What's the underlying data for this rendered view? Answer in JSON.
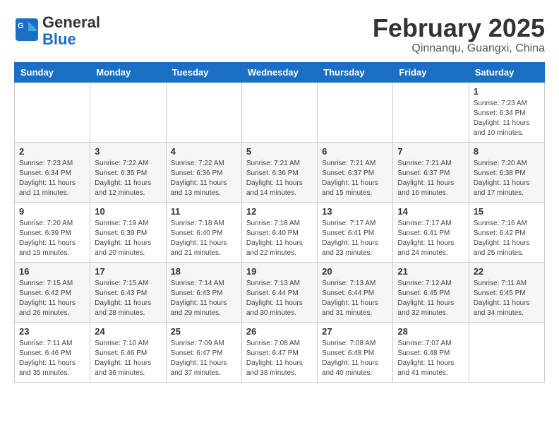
{
  "header": {
    "logo": {
      "line1": "General",
      "line2": "Blue"
    },
    "title": "February 2025",
    "subtitle": "Qinnanqu, Guangxi, China"
  },
  "weekdays": [
    "Sunday",
    "Monday",
    "Tuesday",
    "Wednesday",
    "Thursday",
    "Friday",
    "Saturday"
  ],
  "weeks": [
    [
      {
        "day": "",
        "info": ""
      },
      {
        "day": "",
        "info": ""
      },
      {
        "day": "",
        "info": ""
      },
      {
        "day": "",
        "info": ""
      },
      {
        "day": "",
        "info": ""
      },
      {
        "day": "",
        "info": ""
      },
      {
        "day": "1",
        "info": "Sunrise: 7:23 AM\nSunset: 6:34 PM\nDaylight: 11 hours\nand 10 minutes."
      }
    ],
    [
      {
        "day": "2",
        "info": "Sunrise: 7:23 AM\nSunset: 6:34 PM\nDaylight: 11 hours\nand 11 minutes."
      },
      {
        "day": "3",
        "info": "Sunrise: 7:22 AM\nSunset: 6:35 PM\nDaylight: 11 hours\nand 12 minutes."
      },
      {
        "day": "4",
        "info": "Sunrise: 7:22 AM\nSunset: 6:36 PM\nDaylight: 11 hours\nand 13 minutes."
      },
      {
        "day": "5",
        "info": "Sunrise: 7:21 AM\nSunset: 6:36 PM\nDaylight: 11 hours\nand 14 minutes."
      },
      {
        "day": "6",
        "info": "Sunrise: 7:21 AM\nSunset: 6:37 PM\nDaylight: 11 hours\nand 15 minutes."
      },
      {
        "day": "7",
        "info": "Sunrise: 7:21 AM\nSunset: 6:37 PM\nDaylight: 11 hours\nand 16 minutes."
      },
      {
        "day": "8",
        "info": "Sunrise: 7:20 AM\nSunset: 6:38 PM\nDaylight: 11 hours\nand 17 minutes."
      }
    ],
    [
      {
        "day": "9",
        "info": "Sunrise: 7:20 AM\nSunset: 6:39 PM\nDaylight: 11 hours\nand 19 minutes."
      },
      {
        "day": "10",
        "info": "Sunrise: 7:19 AM\nSunset: 6:39 PM\nDaylight: 11 hours\nand 20 minutes."
      },
      {
        "day": "11",
        "info": "Sunrise: 7:18 AM\nSunset: 6:40 PM\nDaylight: 11 hours\nand 21 minutes."
      },
      {
        "day": "12",
        "info": "Sunrise: 7:18 AM\nSunset: 6:40 PM\nDaylight: 11 hours\nand 22 minutes."
      },
      {
        "day": "13",
        "info": "Sunrise: 7:17 AM\nSunset: 6:41 PM\nDaylight: 11 hours\nand 23 minutes."
      },
      {
        "day": "14",
        "info": "Sunrise: 7:17 AM\nSunset: 6:41 PM\nDaylight: 11 hours\nand 24 minutes."
      },
      {
        "day": "15",
        "info": "Sunrise: 7:16 AM\nSunset: 6:42 PM\nDaylight: 11 hours\nand 25 minutes."
      }
    ],
    [
      {
        "day": "16",
        "info": "Sunrise: 7:15 AM\nSunset: 6:42 PM\nDaylight: 11 hours\nand 26 minutes."
      },
      {
        "day": "17",
        "info": "Sunrise: 7:15 AM\nSunset: 6:43 PM\nDaylight: 11 hours\nand 28 minutes."
      },
      {
        "day": "18",
        "info": "Sunrise: 7:14 AM\nSunset: 6:43 PM\nDaylight: 11 hours\nand 29 minutes."
      },
      {
        "day": "19",
        "info": "Sunrise: 7:13 AM\nSunset: 6:44 PM\nDaylight: 11 hours\nand 30 minutes."
      },
      {
        "day": "20",
        "info": "Sunrise: 7:13 AM\nSunset: 6:44 PM\nDaylight: 11 hours\nand 31 minutes."
      },
      {
        "day": "21",
        "info": "Sunrise: 7:12 AM\nSunset: 6:45 PM\nDaylight: 11 hours\nand 32 minutes."
      },
      {
        "day": "22",
        "info": "Sunrise: 7:11 AM\nSunset: 6:45 PM\nDaylight: 11 hours\nand 34 minutes."
      }
    ],
    [
      {
        "day": "23",
        "info": "Sunrise: 7:11 AM\nSunset: 6:46 PM\nDaylight: 11 hours\nand 35 minutes."
      },
      {
        "day": "24",
        "info": "Sunrise: 7:10 AM\nSunset: 6:46 PM\nDaylight: 11 hours\nand 36 minutes."
      },
      {
        "day": "25",
        "info": "Sunrise: 7:09 AM\nSunset: 6:47 PM\nDaylight: 11 hours\nand 37 minutes."
      },
      {
        "day": "26",
        "info": "Sunrise: 7:08 AM\nSunset: 6:47 PM\nDaylight: 11 hours\nand 38 minutes."
      },
      {
        "day": "27",
        "info": "Sunrise: 7:08 AM\nSunset: 6:48 PM\nDaylight: 11 hours\nand 40 minutes."
      },
      {
        "day": "28",
        "info": "Sunrise: 7:07 AM\nSunset: 6:48 PM\nDaylight: 11 hours\nand 41 minutes."
      },
      {
        "day": "",
        "info": ""
      }
    ]
  ]
}
